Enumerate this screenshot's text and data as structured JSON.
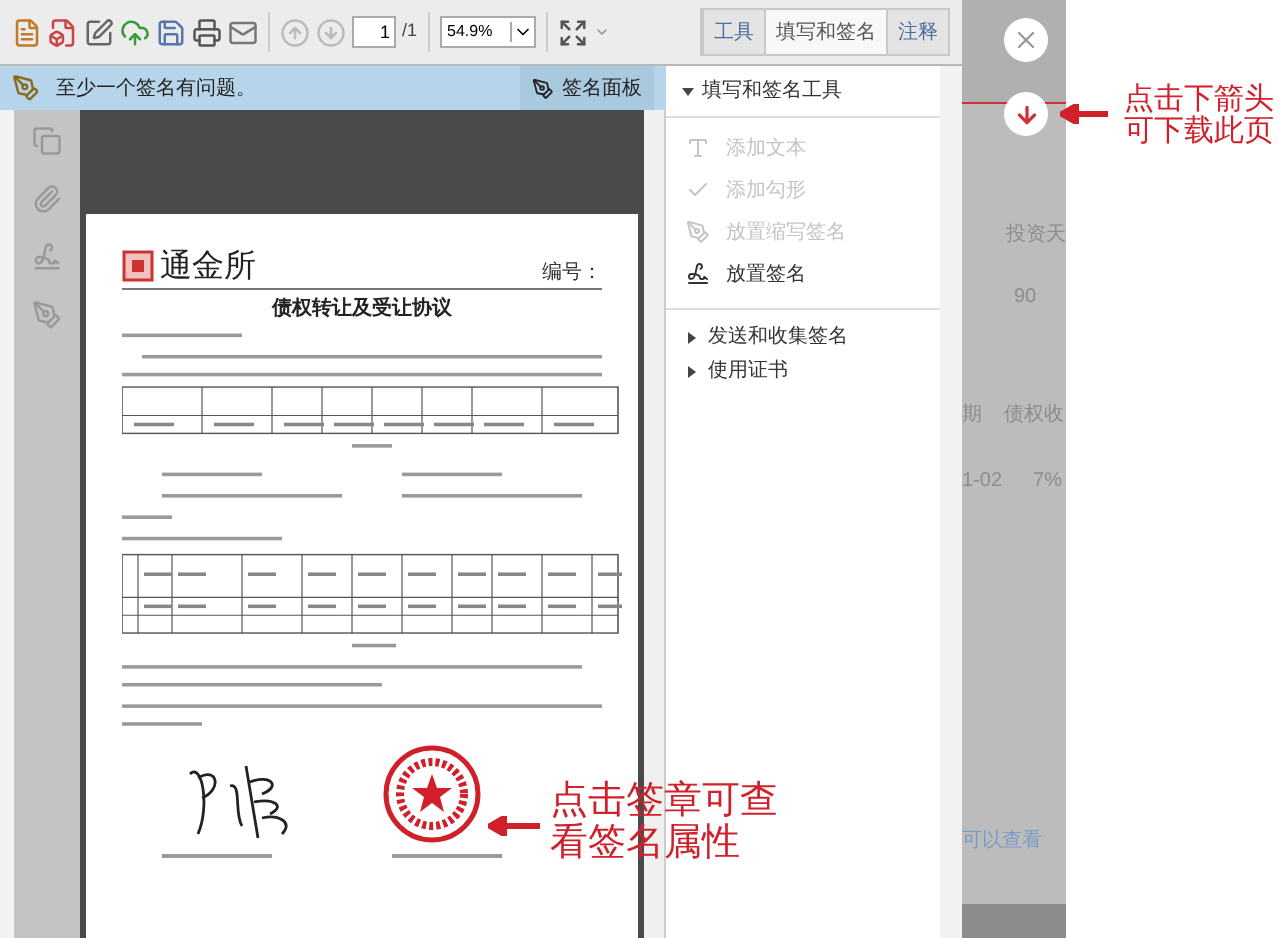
{
  "toolbar": {
    "page": "1",
    "page_total": "/1",
    "zoom": "54.9%",
    "tabs": [
      {
        "label": "工具",
        "selected": false
      },
      {
        "label": "填写和签名",
        "selected": true
      },
      {
        "label": "注释",
        "selected": false
      }
    ]
  },
  "infobar": {
    "message": "至少一个签名有问题。",
    "button": "签名面板"
  },
  "document": {
    "logo": "通金所",
    "number_label": "编号：",
    "title": "债权转让及受让协议"
  },
  "panel": {
    "section": {
      "label": "填写和签名工具",
      "expanded": true
    },
    "tools": [
      {
        "kind": "text",
        "label": "添加文本",
        "disabled": true
      },
      {
        "kind": "check",
        "label": "添加勾形",
        "disabled": true
      },
      {
        "kind": "initials",
        "label": "放置缩写签名",
        "disabled": true
      },
      {
        "kind": "signature",
        "label": "放置签名",
        "disabled": false
      }
    ],
    "more": [
      {
        "label": "发送和收集签名",
        "expanded": false
      },
      {
        "label": "使用证书",
        "expanded": false
      }
    ]
  },
  "background_page": {
    "header": "投资天",
    "value": "90",
    "col_a": "期",
    "col_b": "债权收",
    "cell_a": "1-02",
    "cell_b": "7%",
    "link": "可以查看"
  },
  "annotations": [
    {
      "kind": "download",
      "text": "点击下箭头可下载此页"
    },
    {
      "kind": "seal",
      "text": "点击签章可查看签名属性"
    }
  ]
}
